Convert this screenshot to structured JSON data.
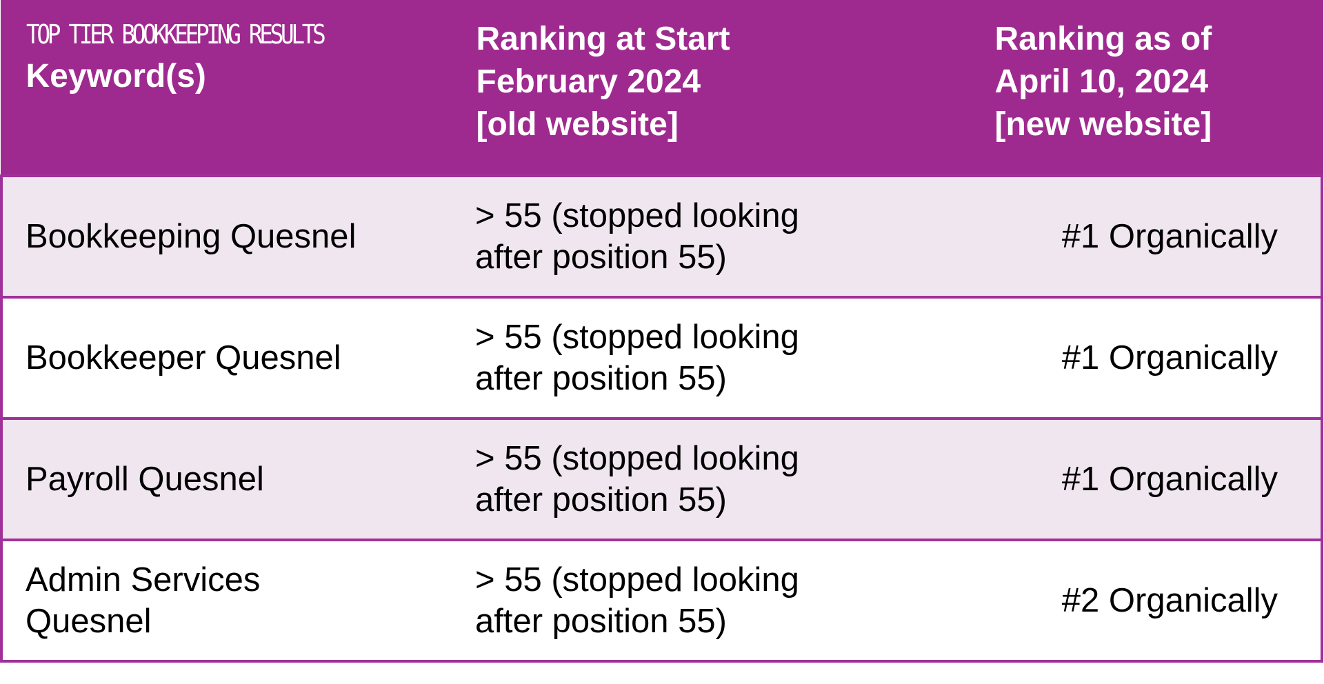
{
  "brand_label": "TOP TIER BOOKKEEPING RESULTS",
  "colors": {
    "header_bg": "#9f2a8f",
    "header_text": "#ffffff",
    "row_alt_bg": "#f0e6f0",
    "row_bg": "#ffffff",
    "border": "#a0309a"
  },
  "table": {
    "headers": [
      {
        "lines": [
          "Keyword(s)"
        ]
      },
      {
        "lines": [
          "Ranking at Start",
          "February 2024",
          "[old website]"
        ]
      },
      {
        "lines": [
          "Ranking as of",
          "April 10, 2024",
          "[new website]"
        ]
      }
    ],
    "rows": [
      {
        "keyword": "Bookkeeping Quesnel",
        "start_line1": "> 55 (stopped looking",
        "start_line2": "after position 55)",
        "current": "#1 Organically"
      },
      {
        "keyword": "Bookkeeper Quesnel",
        "start_line1": "> 55 (stopped looking",
        "start_line2": "after position 55)",
        "current": "#1 Organically"
      },
      {
        "keyword": "Payroll Quesnel",
        "start_line1": "> 55 (stopped looking",
        "start_line2": "after position 55)",
        "current": "#1 Organically"
      },
      {
        "keyword_line1": "Admin Services",
        "keyword_line2": "Quesnel",
        "start_line1": "> 55 (stopped looking",
        "start_line2": "after position 55)",
        "current": "#2 Organically"
      }
    ]
  }
}
